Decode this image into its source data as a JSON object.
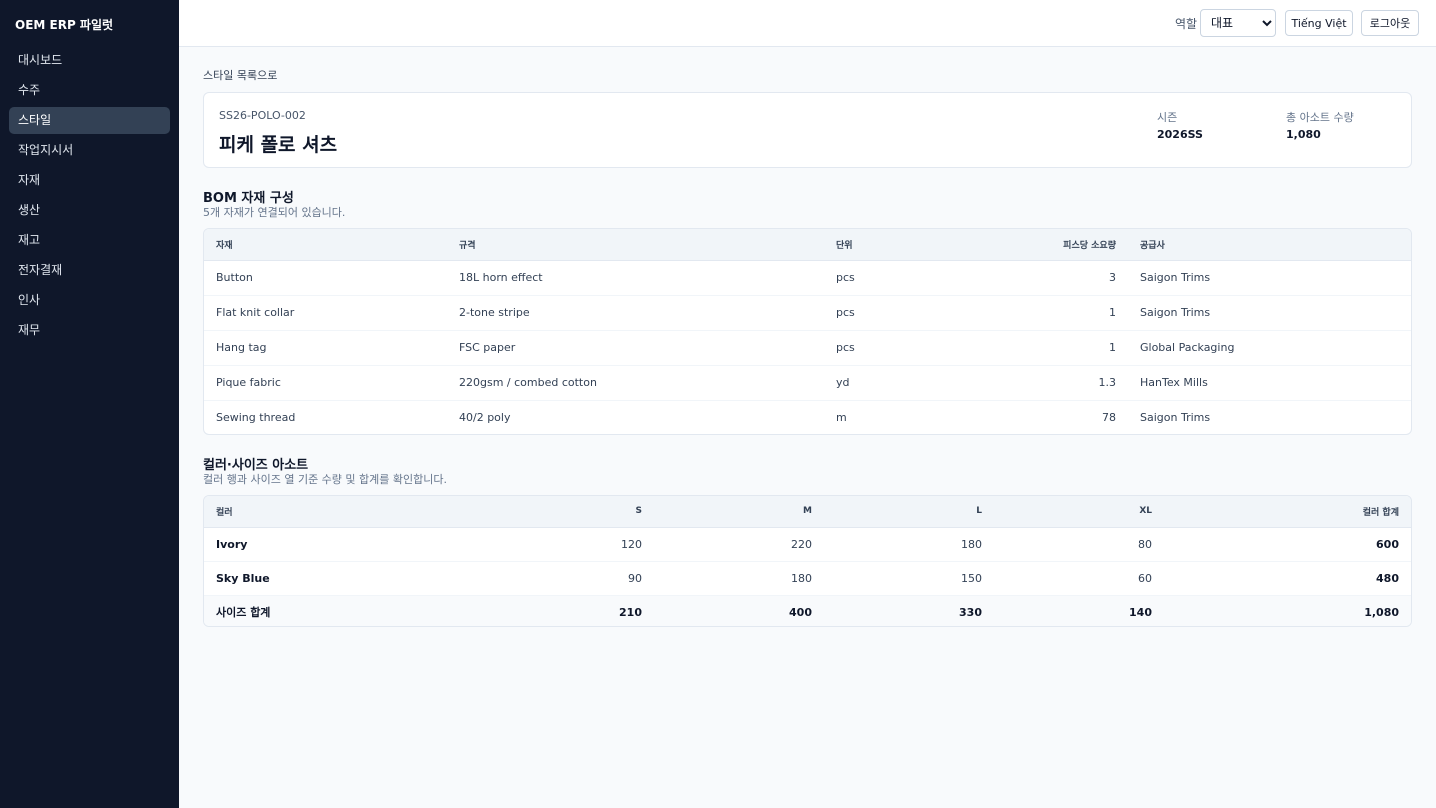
{
  "sidebar": {
    "brand": "OEM ERP 파일럿",
    "items": [
      {
        "label": "대시보드",
        "active": false
      },
      {
        "label": "수주",
        "active": false
      },
      {
        "label": "스타일",
        "active": true
      },
      {
        "label": "작업지시서",
        "active": false
      },
      {
        "label": "자재",
        "active": false
      },
      {
        "label": "생산",
        "active": false
      },
      {
        "label": "재고",
        "active": false
      },
      {
        "label": "전자결재",
        "active": false
      },
      {
        "label": "인사",
        "active": false
      },
      {
        "label": "재무",
        "active": false
      }
    ]
  },
  "header": {
    "role_label": "역할",
    "role_selected": "대표",
    "lang_button": "Tiếng Việt",
    "logout_button": "로그아웃"
  },
  "style": {
    "back_link": "스타일 목록으로",
    "code": "SS26-POLO-002",
    "name": "피케 폴로 셔츠",
    "season_label": "시즌",
    "season_value": "2026SS",
    "total_label": "총 아소트 수량",
    "total_value": "1,080"
  },
  "bom": {
    "title": "BOM 자재 구성",
    "description": "5개 자재가 연결되어 있습니다.",
    "columns": [
      "자재",
      "규격",
      "단위",
      "피스당 소요량",
      "공급사"
    ],
    "rows": [
      [
        "Button",
        "18L horn effect",
        "pcs",
        "3",
        "Saigon Trims"
      ],
      [
        "Flat knit collar",
        "2-tone stripe",
        "pcs",
        "1",
        "Saigon Trims"
      ],
      [
        "Hang tag",
        "FSC paper",
        "pcs",
        "1",
        "Global Packaging"
      ],
      [
        "Pique fabric",
        "220gsm / combed cotton",
        "yd",
        "1.3",
        "HanTex Mills"
      ],
      [
        "Sewing thread",
        "40/2 poly",
        "m",
        "78",
        "Saigon Trims"
      ]
    ]
  },
  "assortment": {
    "title": "컬러·사이즈 아소트",
    "description": "컬러 행과 사이즈 열 기준 수량 및 합계를 확인합니다.",
    "columns": [
      "컬러",
      "S",
      "M",
      "L",
      "XL",
      "컬러 합계"
    ],
    "rows": [
      [
        "Ivory",
        "120",
        "220",
        "180",
        "80",
        "600"
      ],
      [
        "Sky Blue",
        "90",
        "180",
        "150",
        "60",
        "480"
      ]
    ],
    "total_row": [
      "사이즈 합계",
      "210",
      "400",
      "330",
      "140",
      "1,080"
    ]
  }
}
